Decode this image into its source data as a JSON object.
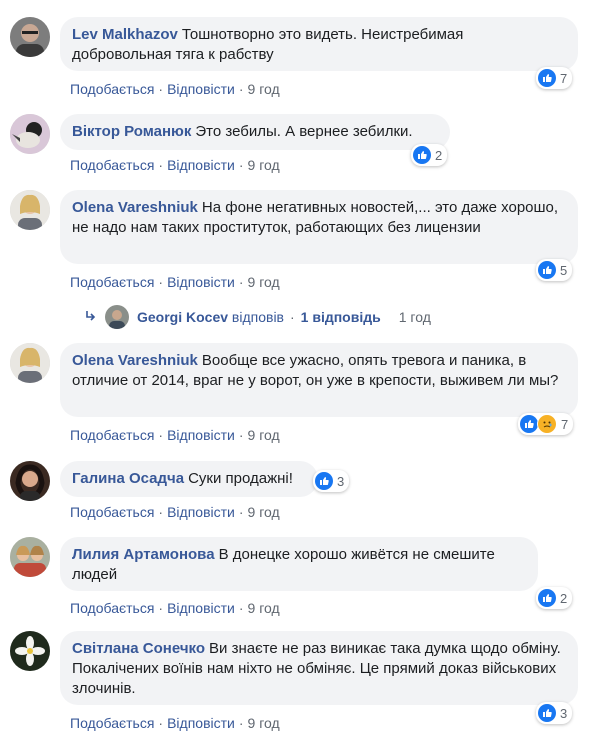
{
  "actions": {
    "like": "Подобається",
    "reply": "Відповісти",
    "sep": "·"
  },
  "comments": [
    {
      "author": "Lev Malkhazov",
      "text": "Тошнотворно это видеть. Неистребимая добровольная тяга к рабству",
      "time": "9 год",
      "reactions": "7"
    },
    {
      "author": "Віктор Романюк",
      "text": "Это зебилы. А вернее зебилки.",
      "time": "9 год",
      "reactions": "2"
    },
    {
      "author": "Olena Vareshniuk",
      "text": "На фоне негативных новостей,... это даже хорошо, не надо нам таких проституток, работающих без лицензии",
      "time": "9 год",
      "reactions": "5"
    },
    {
      "author": "Olena Vareshniuk",
      "text": "Вообще все ужасно, опять тревога и паника, в отличие от 2014, враг не у ворот, он уже в крепости, выживем ли мы?",
      "time": "9 год",
      "reactions": "7"
    },
    {
      "author": "Галина Осадча",
      "text": "Суки продажні!",
      "time": "9 год",
      "reactions": "3"
    },
    {
      "author": "Лилия Артамонова",
      "text": "В донецке хорошо живётся не смешите людей",
      "time": "9 год",
      "reactions": "2"
    },
    {
      "author": "Світлана Сонечко",
      "text": "Ви знаєте не раз виникає така думка щодо обміну. Покалічених воїнів нам ніхто не обміняє. Це прямий доказ військових злочинів.",
      "time": "9 год",
      "reactions": "3"
    }
  ],
  "reply_thread": {
    "author": "Georgi Kocev",
    "verb": "відповів",
    "count": "1 відповідь",
    "time": "1 год"
  },
  "icons": {
    "like": "thumbs-up-icon",
    "sad": "sad-face-icon",
    "reply_arrow": "reply-arrow-icon"
  },
  "colors": {
    "link": "#385898",
    "bubble": "#f2f3f5",
    "like": "#1877f2",
    "muted": "#606770"
  }
}
